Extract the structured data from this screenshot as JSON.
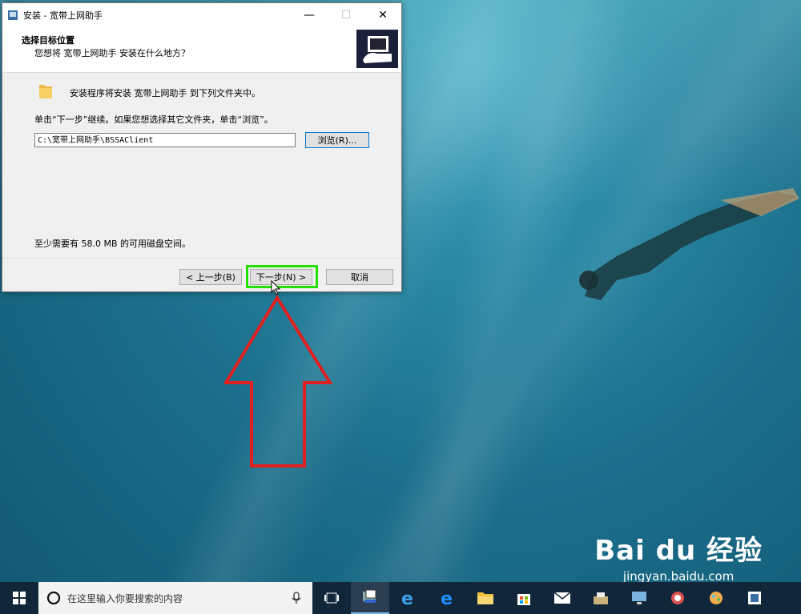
{
  "window": {
    "title": "安装 - 宽带上网助手",
    "minimize": "—",
    "maximize": "☐",
    "close": "✕"
  },
  "header": {
    "heading": "选择目标位置",
    "subheading": "您想将 宽带上网助手 安装在什么地方？"
  },
  "body": {
    "intro": "安装程序将安装 宽带上网助手 到下列文件夹中。",
    "instruction": "单击“下一步”继续。如果您想选择其它文件夹，单击“浏览”。",
    "path_value": "C:\\宽带上网助手\\BSSAClient",
    "browse_label": "浏览(R)...",
    "space_note": "至少需要有 58.0 MB 的可用磁盘空间。"
  },
  "buttons": {
    "back": "< 上一步(B)",
    "next": "下一步(N) >",
    "cancel": "取消"
  },
  "watermark": {
    "brand": "Bai du 经验",
    "url": "jingyan.baidu.com"
  },
  "taskbar": {
    "search_placeholder": "在这里输入你要搜索的内容",
    "icons": [
      "task-view-icon",
      "installer-icon",
      "edge-icon",
      "ie-icon",
      "file-explorer-icon",
      "store-icon",
      "mail-icon",
      "app-icon-1",
      "app-icon-2",
      "app-icon-3",
      "app-icon-4",
      "app-icon-5",
      "app-icon-6"
    ]
  },
  "colors": {
    "highlight": "#22e000",
    "arrow": "#e02020",
    "taskbar": "#12263a"
  }
}
